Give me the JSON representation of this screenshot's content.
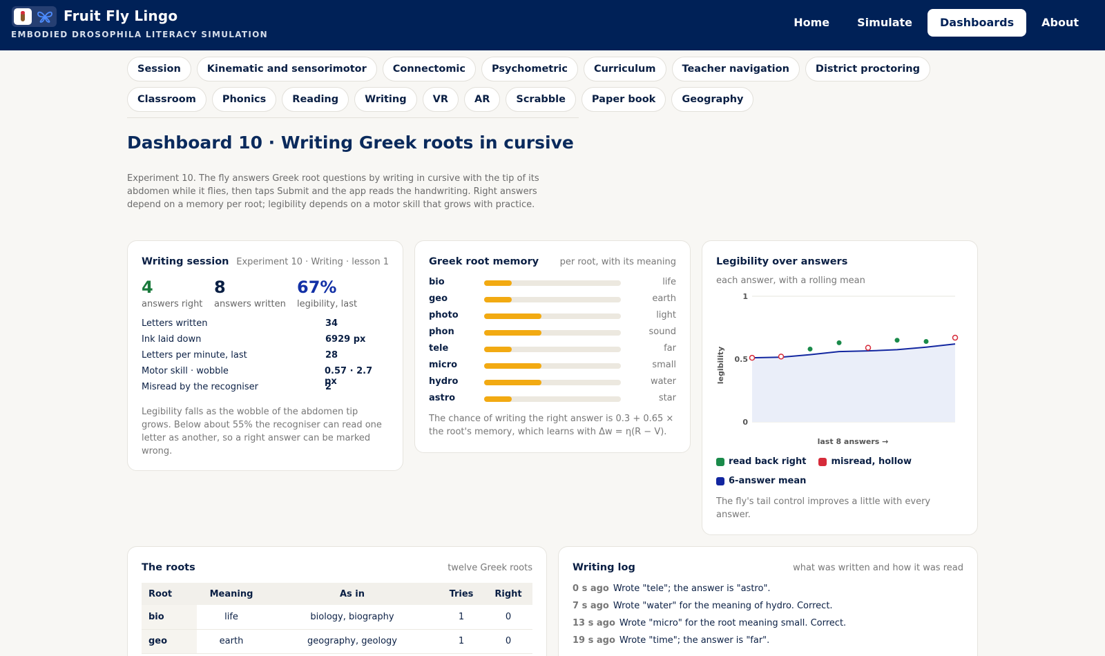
{
  "header": {
    "title": "Fruit Fly Lingo",
    "subtitle": "EMBODIED DROSOPHILA LITERACY SIMULATION",
    "nav": [
      "Home",
      "Simulate",
      "Dashboards",
      "About"
    ],
    "active_nav": "Dashboards"
  },
  "pills_row1": [
    "Session",
    "Kinematic and sensorimotor",
    "Connectomic",
    "Psychometric",
    "Curriculum",
    "Teacher navigation",
    "District proctoring"
  ],
  "pills_row2": [
    "Classroom",
    "Phonics",
    "Reading",
    "Writing",
    "VR",
    "AR",
    "Scrabble",
    "Paper book",
    "Geography"
  ],
  "page": {
    "title": "Dashboard 10 · Writing Greek roots in cursive",
    "intro": "Experiment 10. The fly answers Greek root questions by writing in cursive with the tip of its abdomen while it flies, then taps Submit and the app reads the handwriting. Right answers depend on a memory per root; legibility depends on a motor skill that grows with practice."
  },
  "session": {
    "title": "Writing session",
    "subtitle": "Experiment 10 · Writing · lesson 1",
    "stats": [
      {
        "value": "4",
        "label": "answers right",
        "color": "#1a7a3c"
      },
      {
        "value": "8",
        "label": "answers written",
        "color": "#0a1f44"
      },
      {
        "value": "67%",
        "label": "legibility, last",
        "color": "#1230a6"
      }
    ],
    "rows": [
      {
        "k": "Letters written",
        "v": "34"
      },
      {
        "k": "Ink laid down",
        "v": "6929 px"
      },
      {
        "k": "Letters per minute, last",
        "v": "28"
      },
      {
        "k": "Motor skill · wobble",
        "v": "0.57 · 2.7 px"
      },
      {
        "k": "Misread by the recogniser",
        "v": "2"
      }
    ],
    "note": "Legibility falls as the wobble of the abdomen tip grows. Below about 55% the recogniser can read one letter as another, so a right answer can be marked wrong."
  },
  "memory": {
    "title": "Greek root memory",
    "subtitle": "per root, with its meaning",
    "roots": [
      {
        "root": "bio",
        "meaning": "life",
        "strength": 0.2
      },
      {
        "root": "geo",
        "meaning": "earth",
        "strength": 0.2
      },
      {
        "root": "photo",
        "meaning": "light",
        "strength": 0.42
      },
      {
        "root": "phon",
        "meaning": "sound",
        "strength": 0.42
      },
      {
        "root": "tele",
        "meaning": "far",
        "strength": 0.2
      },
      {
        "root": "micro",
        "meaning": "small",
        "strength": 0.42
      },
      {
        "root": "hydro",
        "meaning": "water",
        "strength": 0.42
      },
      {
        "root": "astro",
        "meaning": "star",
        "strength": 0.2
      }
    ],
    "note": "The chance of writing the right answer is 0.3 + 0.65 × the root's memory, which learns with Δw = η(R − V)."
  },
  "legibility": {
    "title": "Legibility over answers",
    "subtitle": "each answer, with a rolling mean",
    "chart_data": {
      "type": "line",
      "ylabel": "legibility",
      "xlabel": "last 8 answers →",
      "ylim": [
        0,
        1
      ],
      "yticks": [
        "0",
        "0.5",
        "1"
      ],
      "points": [
        {
          "x": 1,
          "y": 0.51,
          "read": "misread"
        },
        {
          "x": 2,
          "y": 0.52,
          "read": "misread"
        },
        {
          "x": 3,
          "y": 0.58,
          "read": "right"
        },
        {
          "x": 4,
          "y": 0.63,
          "read": "right"
        },
        {
          "x": 5,
          "y": 0.59,
          "read": "misread"
        },
        {
          "x": 6,
          "y": 0.65,
          "read": "right"
        },
        {
          "x": 7,
          "y": 0.64,
          "read": "right"
        },
        {
          "x": 8,
          "y": 0.67,
          "read": "misread"
        }
      ],
      "mean": [
        0.51,
        0.515,
        0.535,
        0.56,
        0.565,
        0.575,
        0.595,
        0.62
      ],
      "colors": {
        "right": "#1a8a4a",
        "misread": "#d62b3a",
        "mean": "#1226a0"
      }
    },
    "legend": [
      {
        "label": "read back right",
        "color": "#1a8a4a"
      },
      {
        "label": "misread, hollow",
        "color": "#d62b3a"
      },
      {
        "label": "6-answer mean",
        "color": "#1226a0"
      }
    ],
    "note": "The fly's tail control improves a little with every answer."
  },
  "roots_table": {
    "title": "The roots",
    "subtitle": "twelve Greek roots",
    "headers": [
      "Root",
      "Meaning",
      "As in",
      "Tries",
      "Right"
    ],
    "rows": [
      [
        "bio",
        "life",
        "biology, biography",
        "1",
        "0"
      ],
      [
        "geo",
        "earth",
        "geography, geology",
        "1",
        "0"
      ]
    ]
  },
  "log": {
    "title": "Writing log",
    "subtitle": "what was written and how it was read",
    "entries": [
      {
        "t": "0 s ago",
        "text": "Wrote \"tele\"; the answer is \"astro\"."
      },
      {
        "t": "7 s ago",
        "text": "Wrote \"water\" for the meaning of hydro. Correct."
      },
      {
        "t": "13 s ago",
        "text": "Wrote \"micro\" for the root meaning small. Correct."
      },
      {
        "t": "19 s ago",
        "text": "Wrote \"time\"; the answer is \"far\"."
      }
    ]
  }
}
